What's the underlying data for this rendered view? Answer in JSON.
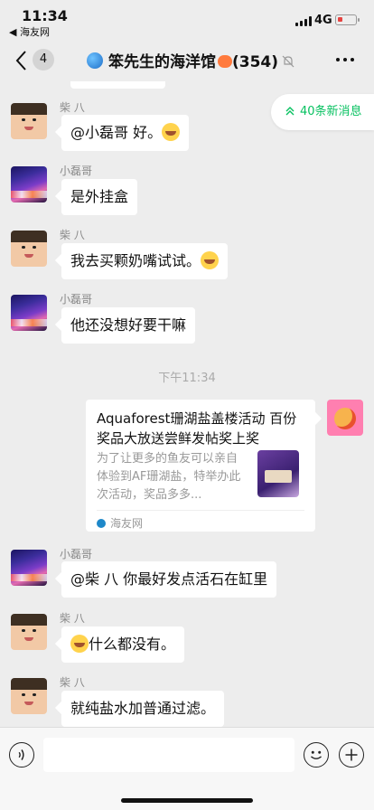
{
  "status_bar": {
    "time": "11:34",
    "back_app": "◀ 海友网",
    "network": "4G"
  },
  "nav": {
    "badge": "4",
    "title": "笨先生的海洋馆",
    "count": "(354)"
  },
  "new_messages": "40条新消息",
  "messages": [
    {
      "sender": "柴 八",
      "text": "@小磊哥 好。"
    },
    {
      "sender": "小磊哥",
      "text": "是外挂盒"
    },
    {
      "sender": "柴 八",
      "text": "我去买颗奶嘴试试。"
    },
    {
      "sender": "小磊哥",
      "text": "他还没想好要干嘛"
    },
    {
      "sender": "小磊哥",
      "text": "@柴 八 你最好发点活石在缸里"
    },
    {
      "sender": "柴 八",
      "text": "什么都没有。"
    },
    {
      "sender": "柴 八",
      "text": "就纯盐水加普通过滤。"
    }
  ],
  "time_divider": "下午11:34",
  "link_card": {
    "title": "Aquaforest珊湖盐盖楼活动 百份奖品大放送尝鲜发帖奖上奖",
    "description": "为了让更多的鱼友可以亲自体验到AF珊湖盐，特举办此次活动，奖品多多...",
    "source": "海友网"
  },
  "input": {
    "placeholder": ""
  }
}
